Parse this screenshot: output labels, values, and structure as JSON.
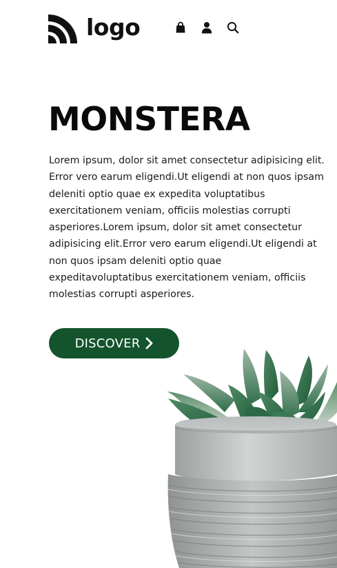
{
  "header": {
    "logo_text": "logo",
    "icons": [
      "logo-mark-icon",
      "shopping-bag-icon",
      "user-icon",
      "search-icon"
    ]
  },
  "hero": {
    "title": "MONSTERA",
    "description": "Lorem ipsum, dolor sit amet consectetur adipisicing elit. Error vero earum eligendi.Ut eligendi at non quos ipsam deleniti optio quae ex expedita voluptatibus exercitationem veniam, officiis molestias corrupti asperiores.Lorem ipsum, dolor sit amet consectetur adipisicing elit.Error vero earum eligendi.Ut eligendi at non quos ipsam deleniti optio quae expeditavoluptatibus exercitationem veniam, officiis molestias corrupti asperiores.",
    "cta_label": "DISCOVER",
    "cta_icon": "chevron-right-icon"
  },
  "colors": {
    "accent": "#13542c",
    "text": "#111111",
    "background": "#ffffff"
  }
}
